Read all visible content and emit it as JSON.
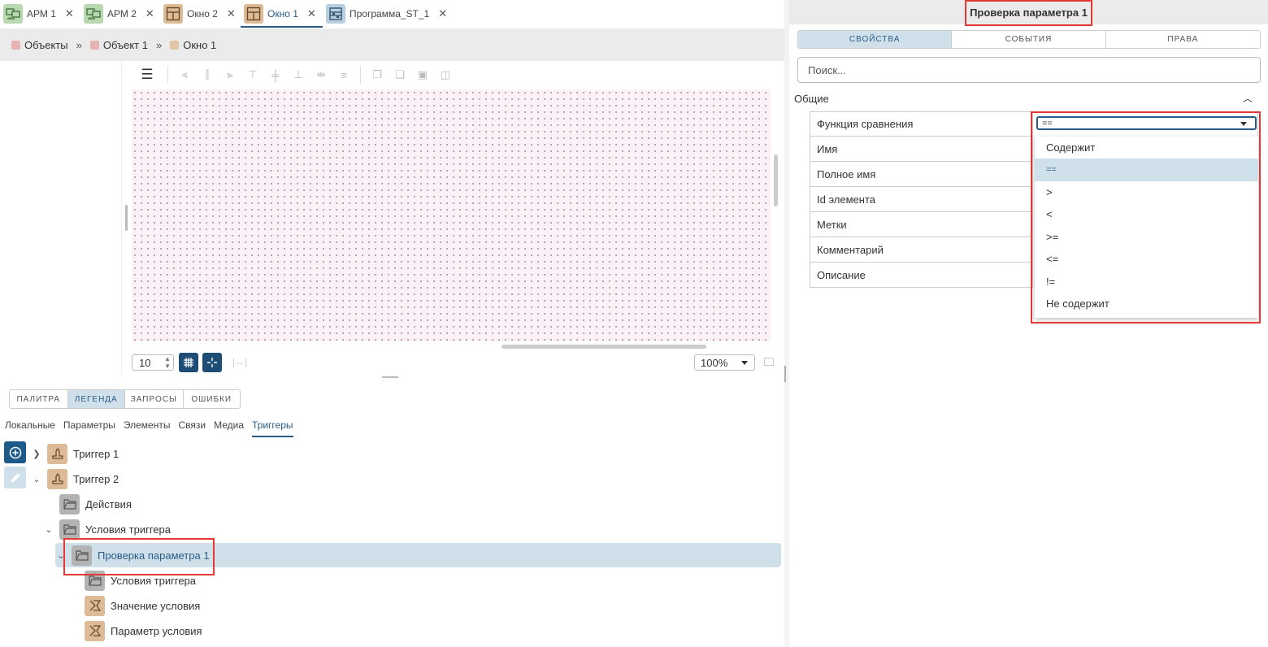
{
  "tabs": [
    {
      "label": "АРМ 1",
      "icon": "workstation-icon",
      "color": "green",
      "active": false
    },
    {
      "label": "АРМ 2",
      "icon": "workstation-icon",
      "color": "green",
      "active": false
    },
    {
      "label": "Окно 2",
      "icon": "window-grid-icon",
      "color": "tan",
      "active": false
    },
    {
      "label": "Окно 1",
      "icon": "window-grid-icon",
      "color": "tan",
      "active": true
    },
    {
      "label": "Программа_ST_1",
      "icon": "program-icon",
      "color": "blue",
      "active": false
    }
  ],
  "breadcrumb": {
    "items": [
      "Объекты",
      "Объект 1",
      "Окно 1"
    ],
    "separator": "»",
    "colors": [
      "#e8b3b3",
      "#e8b3b3",
      "#e3c6a8"
    ]
  },
  "canvas_footer": {
    "grid_size": "10",
    "zoom": "100%"
  },
  "bottom_panel": {
    "main_tabs": [
      "ПАЛИТРА",
      "ЛЕГЕНДА",
      "ЗАПРОСЫ",
      "ОШИБКИ"
    ],
    "active_main_tab": "ЛЕГЕНДА",
    "sub_tabs": [
      "Локальные",
      "Параметры",
      "Элементы",
      "Связи",
      "Медиа",
      "Триггеры"
    ],
    "active_sub_tab": "Триггеры",
    "tree": [
      {
        "label": "Триггер 1",
        "icon": "trigger-icon"
      },
      {
        "label": "Триггер 2",
        "icon": "trigger-icon"
      },
      {
        "label": "Действия",
        "icon": "folder-icon"
      },
      {
        "label": "Условия триггера",
        "icon": "folder-icon"
      },
      {
        "label": "Проверка параметра 1",
        "icon": "folder-icon",
        "selected": true
      },
      {
        "label": "Условия триггера",
        "icon": "folder-icon"
      },
      {
        "label": "Значение условия",
        "icon": "condition-icon"
      },
      {
        "label": "Параметр условия",
        "icon": "condition-icon"
      }
    ]
  },
  "right_panel": {
    "title": "Проверка параметра 1",
    "tabs": [
      "СВОЙСТВА",
      "СОБЫТИЯ",
      "ПРАВА"
    ],
    "active_tab": "СВОЙСТВА",
    "search_placeholder": "Поиск...",
    "section": "Общие",
    "properties": [
      "Функция сравнения",
      "Имя",
      "Полное имя",
      "Id элемента",
      "Метки",
      "Комментарий",
      "Описание"
    ],
    "comparison_value": "==",
    "options": [
      "Содержит",
      "==",
      ">",
      "<",
      ">=",
      "<=",
      "!=",
      "Не содержит"
    ],
    "selected_option": "=="
  },
  "colors": {
    "accent": "#2a5b86",
    "selection": "#cfe0ea",
    "highlight_border": "#e53935"
  }
}
